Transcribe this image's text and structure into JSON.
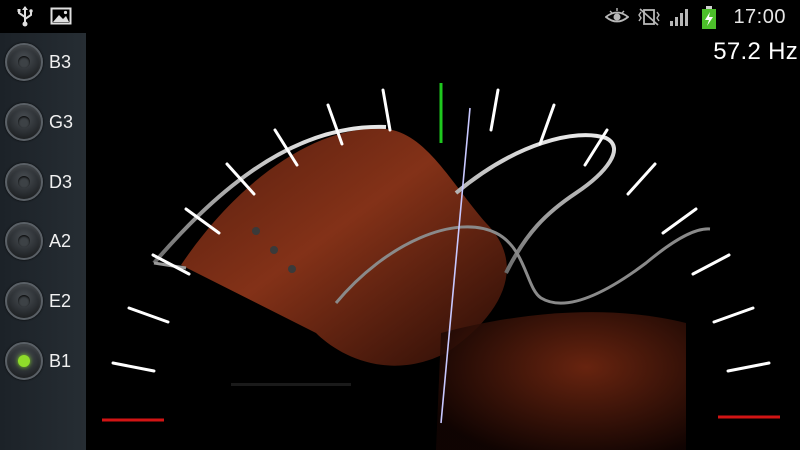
{
  "status_bar": {
    "left_icons": [
      "usb-icon",
      "image-icon"
    ],
    "right_icons": [
      "eye-icon",
      "vibrate-icon",
      "signal-icon",
      "battery-icon"
    ],
    "time": "17:00"
  },
  "strings": [
    {
      "label": "B3",
      "active": false
    },
    {
      "label": "G3",
      "active": false
    },
    {
      "label": "D3",
      "active": false
    },
    {
      "label": "A2",
      "active": false
    },
    {
      "label": "E2",
      "active": false
    },
    {
      "label": "B1",
      "active": true
    }
  ],
  "frequency": "57.2 Hz",
  "colors": {
    "active_dot": "#8fdc2a",
    "center_tick": "#1ec81e",
    "end_markers": "#d21414",
    "needle": "#c8c8ff",
    "ticks": "#ffffff"
  }
}
